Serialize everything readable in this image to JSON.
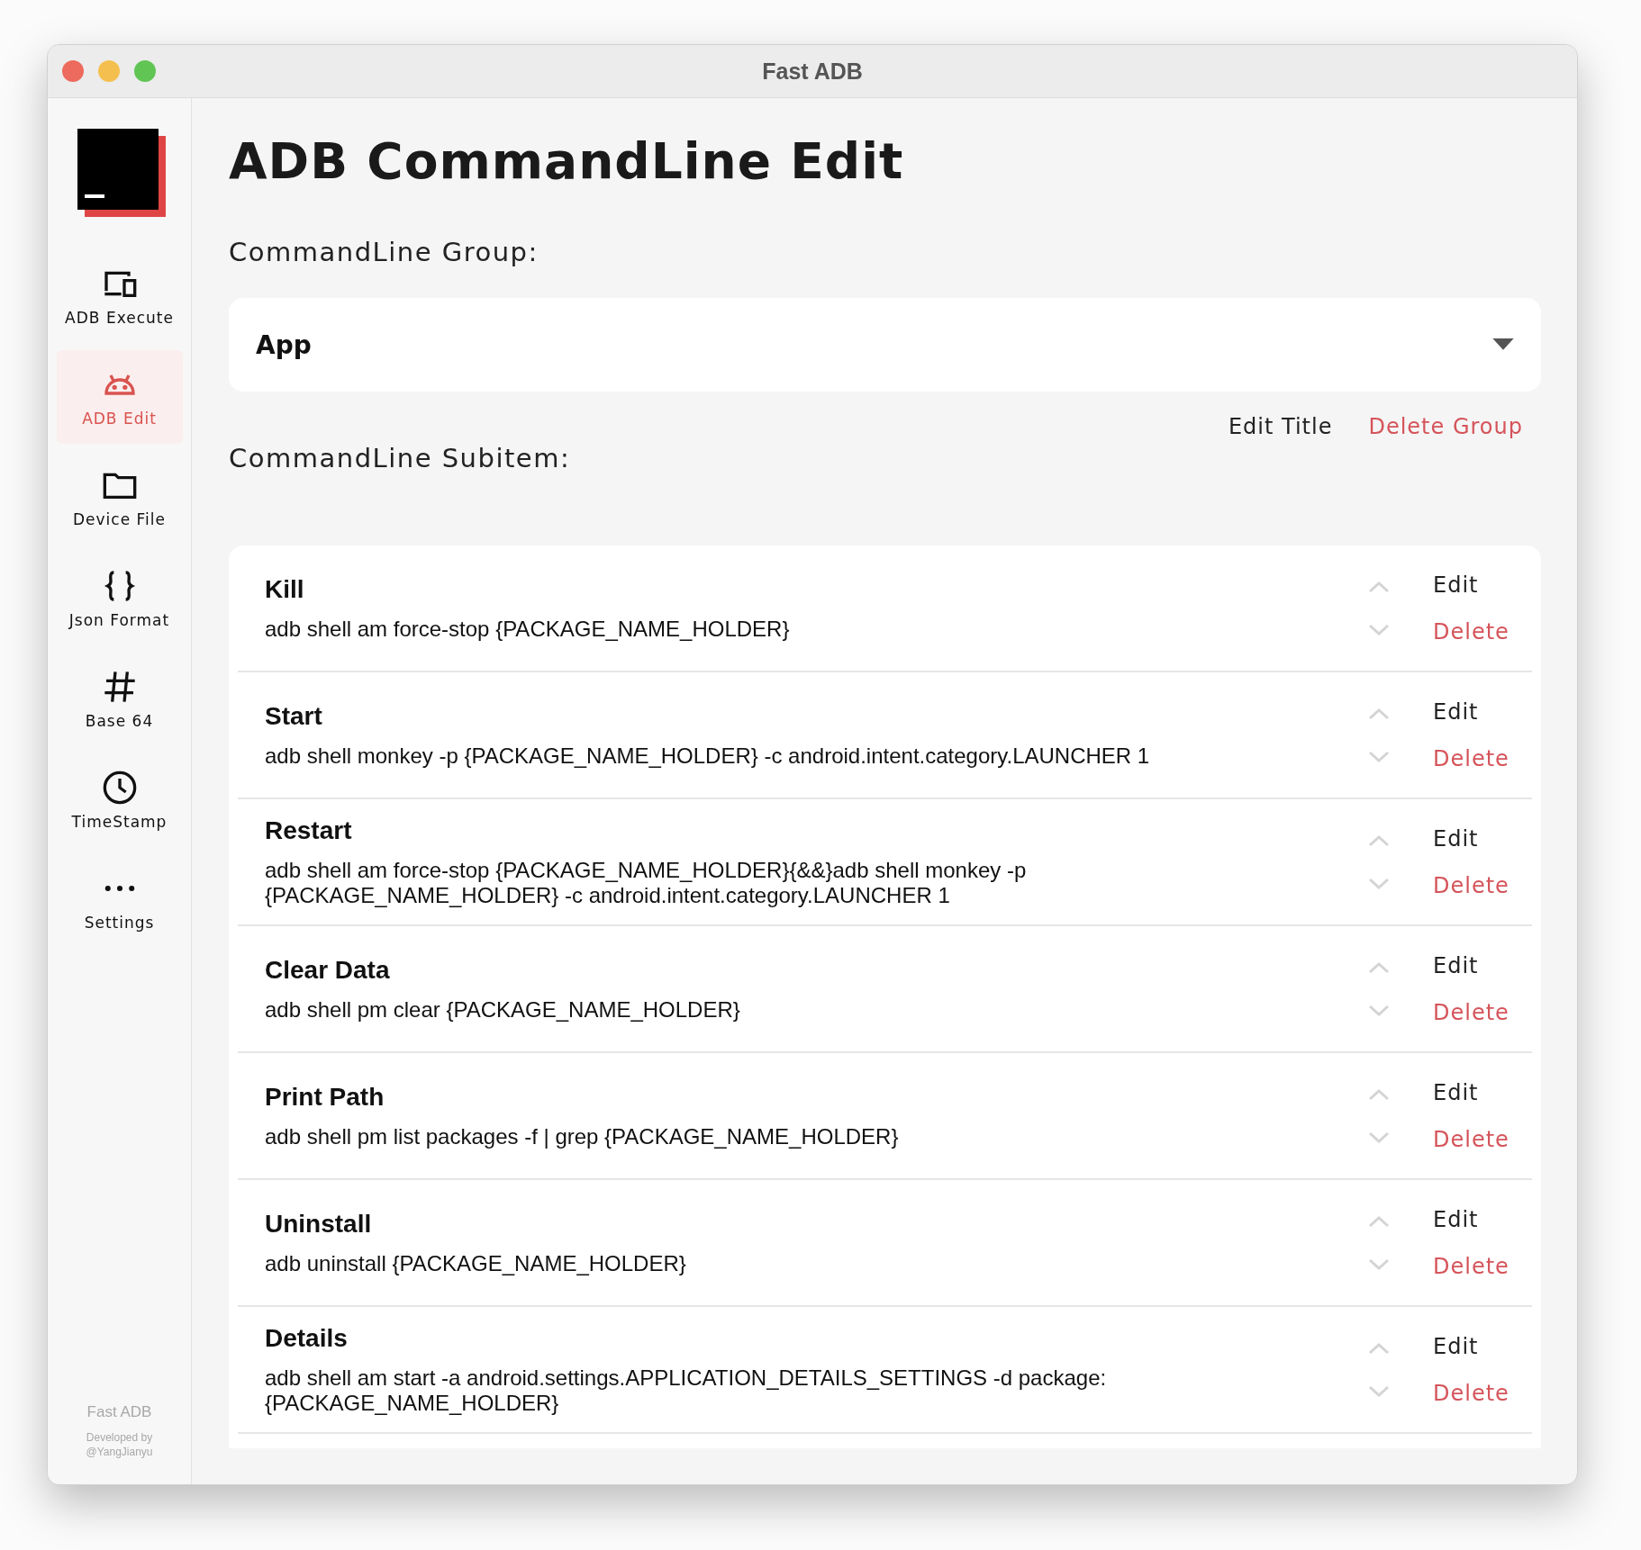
{
  "window": {
    "title": "Fast ADB"
  },
  "sidebar": {
    "items": [
      {
        "label": "ADB Execute",
        "kind": "devices",
        "selected": false
      },
      {
        "label": "ADB Edit",
        "kind": "android",
        "selected": true
      },
      {
        "label": "Device File",
        "kind": "folder",
        "selected": false
      },
      {
        "label": "Json Format",
        "kind": "braces",
        "selected": false
      },
      {
        "label": "Base 64",
        "kind": "hash",
        "selected": false
      },
      {
        "label": "TimeStamp",
        "kind": "clock",
        "selected": false
      },
      {
        "label": "Settings",
        "kind": "dots",
        "selected": false
      }
    ],
    "footer": {
      "app": "Fast ADB",
      "credit": "Developed by @YangJianyu"
    }
  },
  "page": {
    "title": "ADB CommandLine Edit",
    "group_label": "CommandLine Group:",
    "group_value": "App",
    "edit_title": "Edit Title",
    "delete_group": "Delete Group",
    "subitem_label": "CommandLine Subitem:"
  },
  "commands": [
    {
      "name": "Kill",
      "command": "adb shell am force-stop {PACKAGE_NAME_HOLDER}",
      "edit": "Edit",
      "delete": "Delete"
    },
    {
      "name": "Start",
      "command": "adb shell monkey -p {PACKAGE_NAME_HOLDER} -c android.intent.category.LAUNCHER 1",
      "edit": "Edit",
      "delete": "Delete"
    },
    {
      "name": "Restart",
      "command": "adb shell am force-stop {PACKAGE_NAME_HOLDER}{&&}adb shell monkey -p\n{PACKAGE_NAME_HOLDER} -c android.intent.category.LAUNCHER 1",
      "edit": "Edit",
      "delete": "Delete"
    },
    {
      "name": "Clear Data",
      "command": "adb shell pm clear {PACKAGE_NAME_HOLDER}",
      "edit": "Edit",
      "delete": "Delete"
    },
    {
      "name": "Print Path",
      "command": "adb shell pm list packages -f | grep {PACKAGE_NAME_HOLDER}",
      "edit": "Edit",
      "delete": "Delete"
    },
    {
      "name": "Uninstall",
      "command": "adb uninstall {PACKAGE_NAME_HOLDER}",
      "edit": "Edit",
      "delete": "Delete"
    },
    {
      "name": "Details",
      "command": "adb shell am start -a android.settings.APPLICATION_DETAILS_SETTINGS -d package:\n{PACKAGE_NAME_HOLDER}",
      "edit": "Edit",
      "delete": "Delete"
    }
  ]
}
